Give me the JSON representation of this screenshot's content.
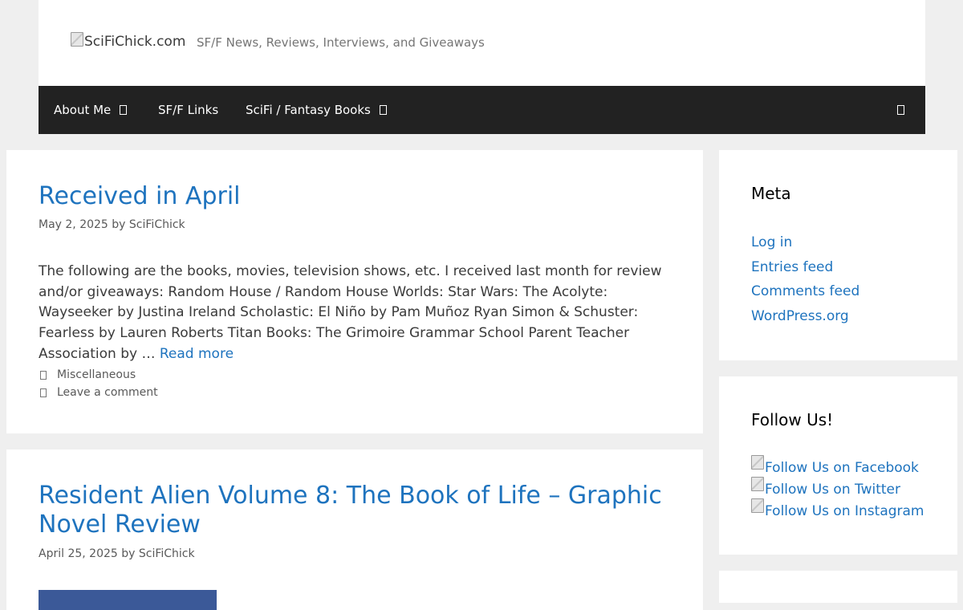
{
  "header": {
    "logo_alt": "SciFiChick.com",
    "tagline": "SF/F News, Reviews, Interviews, and Giveaways"
  },
  "nav": {
    "items": [
      {
        "label": "About Me",
        "has_dropdown": true
      },
      {
        "label": "SF/F Links",
        "has_dropdown": false
      },
      {
        "label": "SciFi / Fantasy Books",
        "has_dropdown": true
      }
    ],
    "search_icon": "search-icon"
  },
  "posts": [
    {
      "title": "Received in April",
      "date": "May 2, 2025",
      "by": "by",
      "author": "SciFiChick",
      "excerpt": "The following are the books, movies, television shows, etc. I received last month for review and/or giveaways: Random House / Random House Worlds: Star Wars: The Acolyte: Wayseeker by Justina Ireland Scholastic: El Niño by Pam Muñoz Ryan Simon & Schuster: Fearless by Lauren Roberts Titan Books: The Grimoire Grammar School Parent Teacher Association by …",
      "read_more": "Read more",
      "category": "Miscellaneous",
      "comment_link": "Leave a comment"
    },
    {
      "title": "Resident Alien Volume 8: The Book of Life – Graphic Novel Review",
      "date": "April 25, 2025",
      "by": "by",
      "author": "SciFiChick"
    }
  ],
  "sidebar": {
    "meta": {
      "title": "Meta",
      "links": [
        "Log in",
        "Entries feed",
        "Comments feed",
        "WordPress.org"
      ]
    },
    "follow": {
      "title": "Follow Us!",
      "links": [
        "Follow Us on Facebook",
        "Follow Us on Twitter",
        "Follow Us on Instagram"
      ]
    }
  },
  "colors": {
    "background": "#efefef",
    "link": "#1e73be",
    "nav_bg": "#222222",
    "text": "#3a3a3a"
  }
}
